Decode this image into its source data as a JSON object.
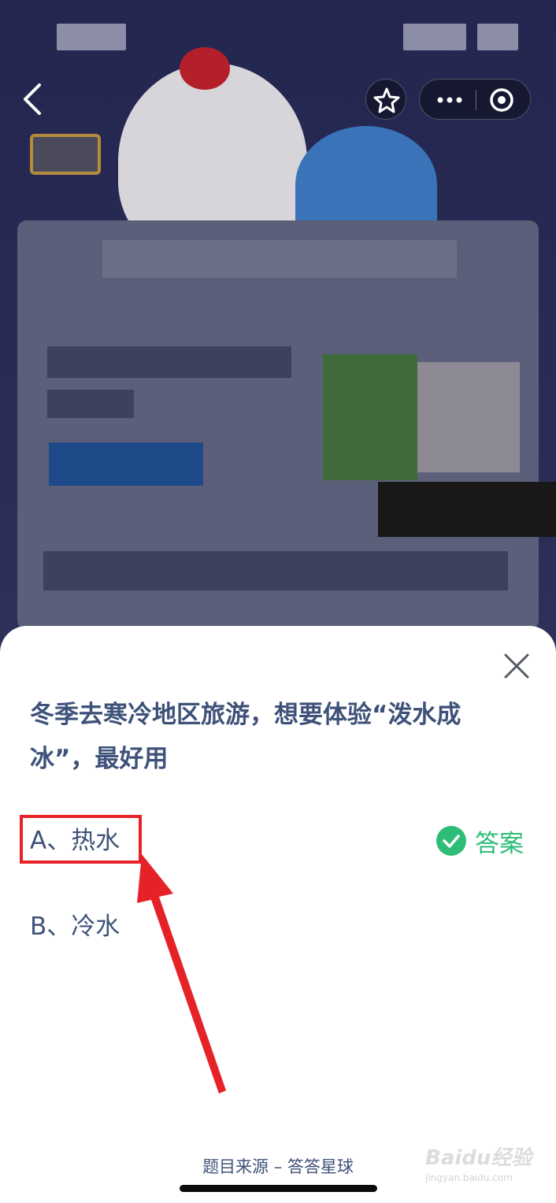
{
  "quiz": {
    "question": "冬季去寒冷地区旅游，想要体验“泼水成冰”，最好用",
    "options": [
      {
        "label": "A、热水",
        "highlighted": true
      },
      {
        "label": "B、冷水",
        "highlighted": false
      }
    ],
    "answer_label": "答案",
    "source": "题目来源 – 答答星球"
  },
  "watermark": {
    "brand": "Baidu经验",
    "url": "jingyan.baidu.com"
  },
  "colors": {
    "question_text": "#3e5279",
    "answer_green": "#2ebd77",
    "highlight_red": "#e62229",
    "arrow_red": "#e62229",
    "dim_background": "#23264f"
  },
  "icons": {
    "back": "chevron-left-icon",
    "favorite": "star-icon",
    "more": "more-dots-icon",
    "miniapp": "target-icon",
    "close": "close-icon",
    "answer": "check-circle-icon"
  }
}
